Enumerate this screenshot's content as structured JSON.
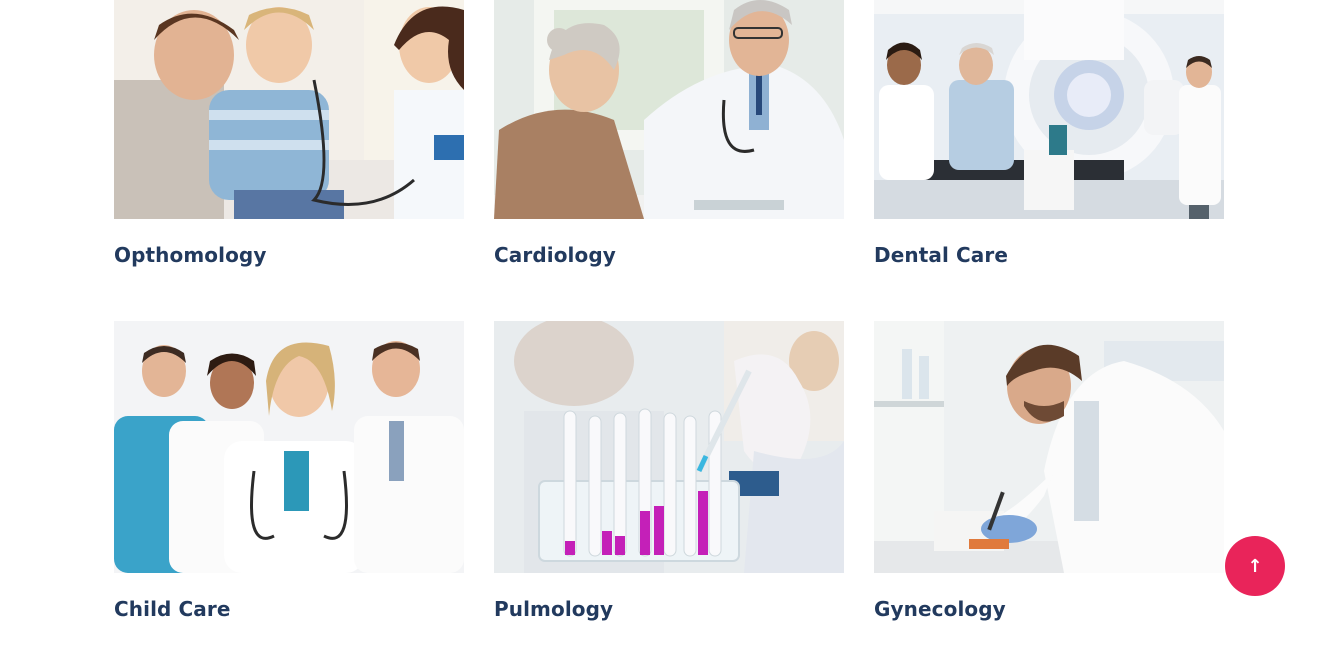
{
  "services": [
    {
      "title": "Opthomology",
      "image": "pediatric-checkup-photo"
    },
    {
      "title": "Cardiology",
      "image": "doctor-elderly-patient-photo"
    },
    {
      "title": "Dental Care",
      "image": "radiotherapy-room-photo"
    },
    {
      "title": "Child Care",
      "image": "medical-team-photo"
    },
    {
      "title": "Pulmology",
      "image": "test-tubes-lab-photo"
    },
    {
      "title": "Gynecology",
      "image": "lab-researcher-photo"
    }
  ],
  "scroll_top": {
    "icon": "arrow-up-icon",
    "glyph": "↑"
  },
  "colors": {
    "title": "#223a5e",
    "accent": "#e9245a",
    "background": "#ffffff"
  }
}
